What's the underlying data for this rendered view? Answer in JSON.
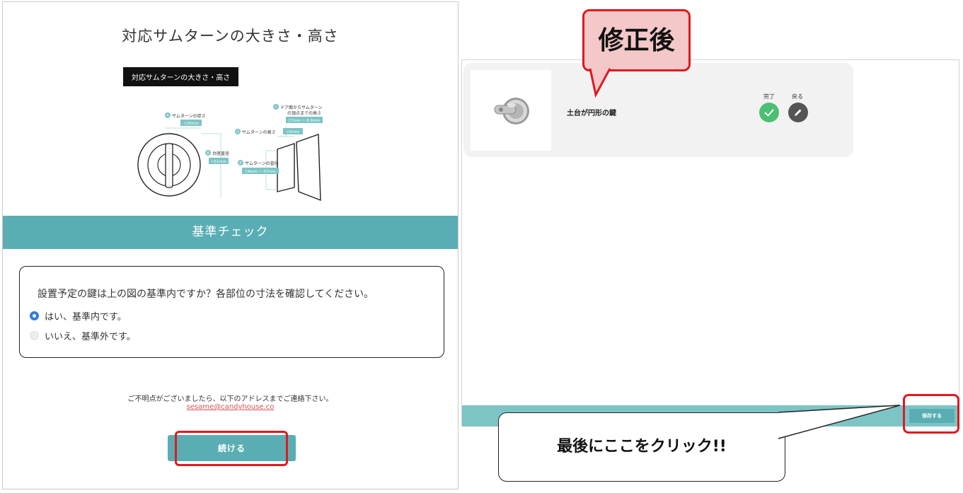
{
  "left": {
    "title": "対応サムターンの大きさ・高さ",
    "diagram": {
      "caption": "対応サムターンの大きさ・高さ",
      "labels": {
        "a_label": "サムターンの厚さ",
        "a_value": "<20mm",
        "b_label": "台座直径",
        "b_value": "<51mm",
        "c_label_1": "ドア面からサムターン",
        "c_label_2": "の頂点までの高さ",
        "c_value": "17mm ~ 8.9mm",
        "d_label": "サムターンの高さ",
        "d_value": ">5mm",
        "e_label": "サムターンの直径",
        "e_value": "14mm ~ 47mm"
      },
      "markers": {
        "a": "A",
        "b": "B",
        "c": "C",
        "d": "D",
        "e": "E"
      }
    },
    "criteria_bar": "基準チェック",
    "question": "設置予定の鍵は上の図の基準内ですか？各部位の寸法を確認してください。",
    "options": [
      {
        "label": "はい、基準内です。",
        "selected": true
      },
      {
        "label": "いいえ、基準外です。",
        "selected": false
      }
    ],
    "contact_text": "ご不明点がございましたら、以下のアドレスまでご連絡下さい。",
    "contact_email": "sesame@candyhouse.co",
    "continue_label": "続ける"
  },
  "right": {
    "lock_name": "土台が円形の鍵",
    "done_label": "完了",
    "back_label": "戻る",
    "save_label": "保存する"
  },
  "callouts": {
    "after_fix": "修正後",
    "click_here": "最後にここをクリック!!"
  },
  "colors": {
    "teal": "#5aaeb3",
    "footer_teal": "#7dc4c6",
    "highlight_red": "#e0191f",
    "radio_blue": "#2f7fe0",
    "done_green": "#4bbf73"
  },
  "icons": {
    "done": "check-icon",
    "back": "pencil-icon",
    "lock": "thumbturn-lock-icon"
  }
}
